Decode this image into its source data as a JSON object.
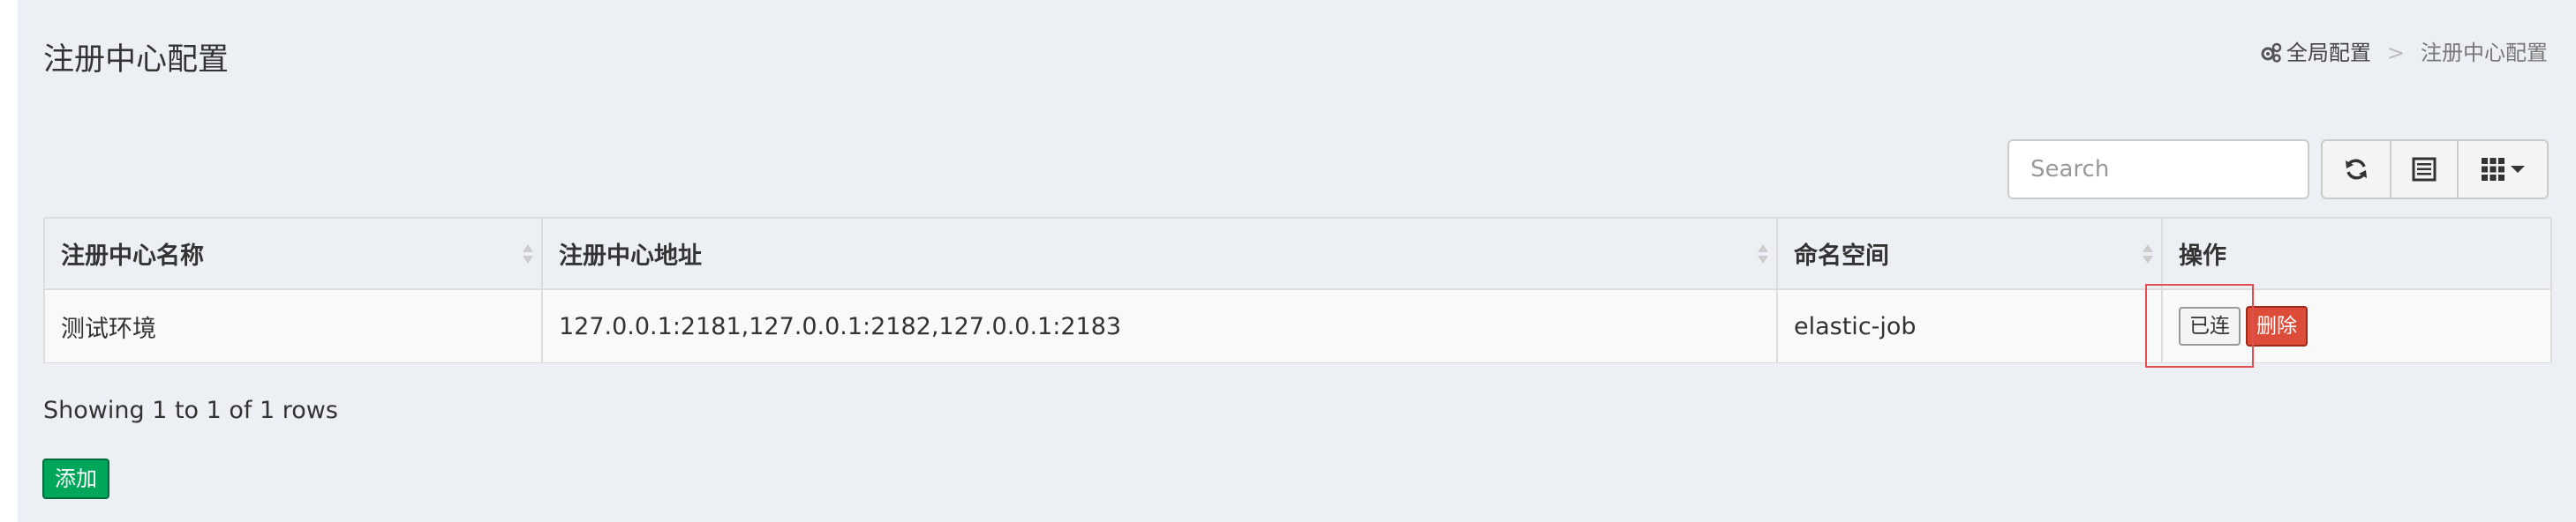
{
  "page": {
    "title": "注册中心配置"
  },
  "breadcrumb": {
    "root": "全局配置",
    "separator": ">",
    "current": "注册中心配置"
  },
  "toolbar": {
    "search_placeholder": "Search",
    "refresh_icon": "refresh-icon",
    "list_icon": "list-view-icon",
    "columns_icon": "grid-columns-icon"
  },
  "table": {
    "columns": [
      "注册中心名称",
      "注册中心地址",
      "命名空间",
      "操作"
    ],
    "rows": [
      {
        "name": "测试环境",
        "address": "127.0.0.1:2181,127.0.0.1:2182,127.0.0.1:2183",
        "namespace": "elastic-job",
        "actions": {
          "connected": "已连",
          "delete": "删除"
        }
      }
    ]
  },
  "pagination": {
    "info": "Showing 1 to 1 of 1 rows"
  },
  "add_button": {
    "label": "添加"
  },
  "colors": {
    "background": "#ecf0f5",
    "danger": "#dd4b39",
    "success": "#00a65a",
    "highlight": "#e05050"
  }
}
